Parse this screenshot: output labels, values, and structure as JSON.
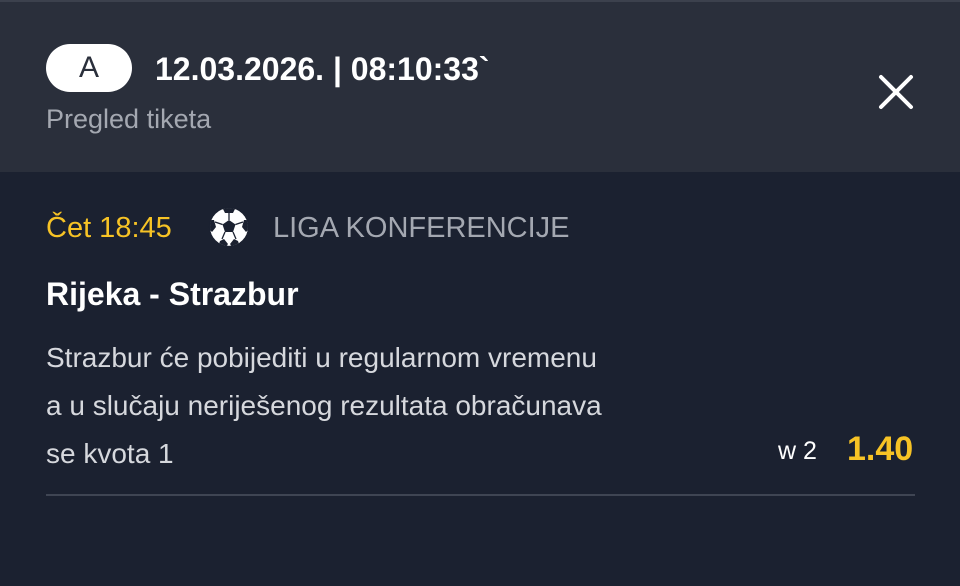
{
  "header": {
    "badge": "A",
    "datetime": "12.03.2026. | 08:10:33`",
    "subtitle": "Pregled tiketa",
    "close_icon": "close-icon"
  },
  "event": {
    "time": "Čet 18:45",
    "sport_icon": "soccer-ball-icon",
    "league": "LIGA KONFERENCIJE",
    "match": "Rijeka - Strazbur",
    "description_lines": [
      "Strazbur će pobijediti u regularnom vremenu",
      "a u slučaju neriješenog rezultata obračunava",
      "se kvota 1"
    ],
    "bet_code": "w 2",
    "odds": "1.40"
  },
  "colors": {
    "header_bg": "#2a2f3b",
    "content_bg": "#1b2130",
    "accent": "#f7c325",
    "muted_text": "#a4a8b1"
  }
}
